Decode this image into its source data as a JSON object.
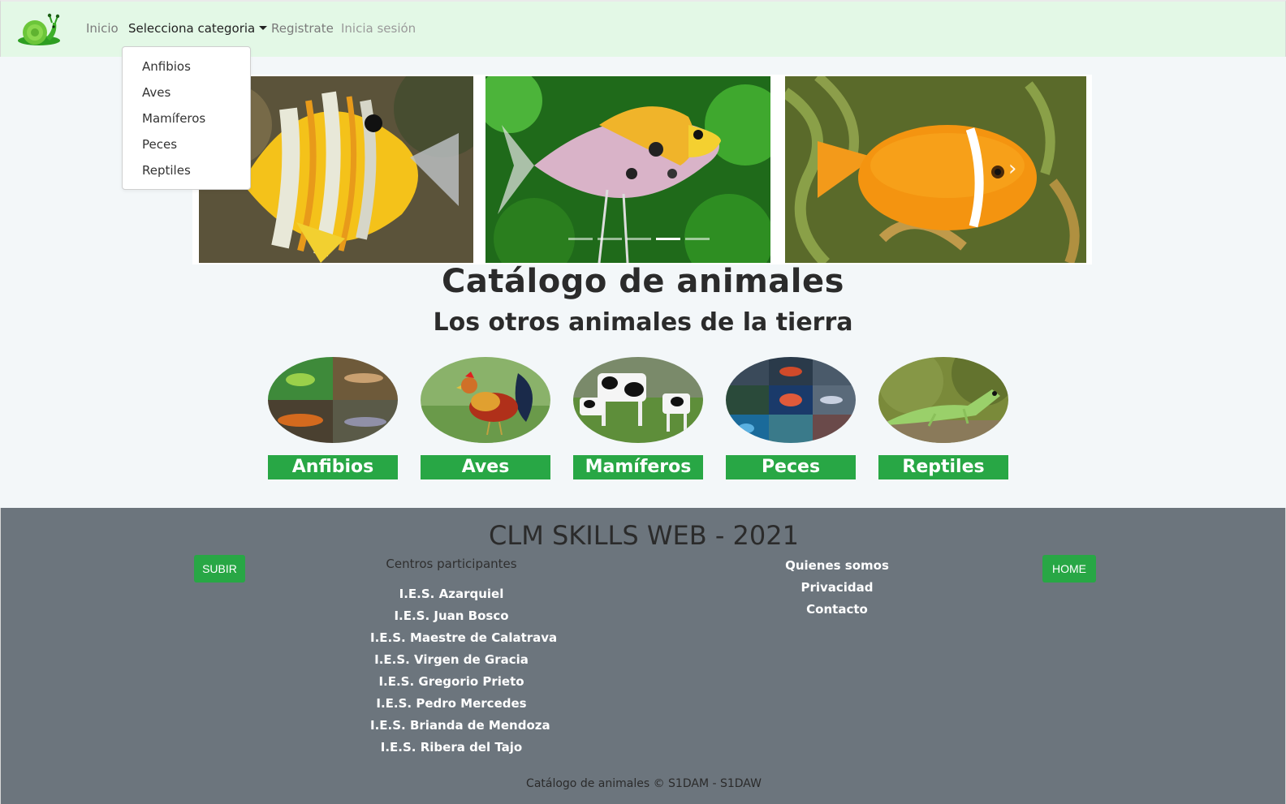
{
  "navbar": {
    "links": {
      "inicio": "Inicio",
      "categoria": "Selecciona categoria",
      "registro": "Registrate",
      "login": "Inicia sesión"
    },
    "dropdown": [
      "Anfibios",
      "Aves",
      "Mamíferos",
      "Peces",
      "Reptiles"
    ]
  },
  "carousel": {
    "slide_count": 5,
    "active_index": 3
  },
  "main": {
    "title": "Catálogo de animales",
    "subtitle": "Los otros animales de la tierra",
    "categories": [
      "Anfibios",
      "Aves",
      "Mamíferos",
      "Peces",
      "Reptiles"
    ]
  },
  "footer": {
    "title": "CLM SKILLS WEB - 2021",
    "subir": "SUBIR",
    "home": "HOME",
    "centros_heading": "Centros participantes",
    "centros": [
      "I.E.S. Azarquiel",
      "I.E.S. Juan Bosco",
      "I.E.S. Maestre de Calatrava",
      "I.E.S. Virgen de Gracia",
      "I.E.S. Gregorio Prieto",
      "I.E.S. Pedro Mercedes",
      "I.E.S. Brianda de Mendoza",
      "I.E.S. Ribera del Tajo"
    ],
    "links": [
      "Quienes somos",
      "Privacidad",
      "Contacto"
    ],
    "copyright": "Catálogo de animales © S1DAM - S1DAW"
  },
  "colors": {
    "navbar_bg": "#e3f8e6",
    "accent_green": "#28a745",
    "footer_bg": "#6c757d",
    "page_bg": "#f3f7f9"
  },
  "icons": [
    "snail-logo-icon",
    "caret-down-icon",
    "chevron-right-icon"
  ]
}
